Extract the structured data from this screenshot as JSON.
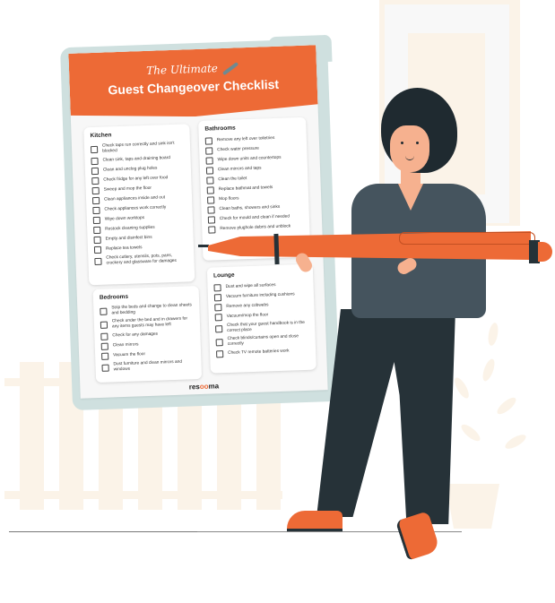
{
  "header": {
    "title_small": "The Ultimate",
    "title_big": "Guest Changeover Checklist"
  },
  "sections": {
    "kitchen": {
      "heading": "Kitchen",
      "items": [
        "Check taps run correctly and sink isn't blocked",
        "Clean sink, taps and draining board",
        "Clean and unclog plug holes",
        "Check fridge for any left over food",
        "Sweep and mop the floor",
        "Clean appliances inside and out",
        "Check appliances work correctly",
        "Wipe down worktops",
        "Restock cleaning supplies",
        "Empty and disinfect bins",
        "Replace tea towels",
        "Check cutlery, utensils, pots, pans, crockery and glassware for damages"
      ]
    },
    "bathrooms": {
      "heading": "Bathrooms",
      "items": [
        "Remove any left over toiletries",
        "Check water pressure",
        "Wipe down units and countertops",
        "Clean mirrors and taps",
        "Clean the toilet",
        "Replace bathmat and towels",
        "Mop floors",
        "Clean baths, showers and sinks",
        "Check for mould and clean if needed",
        "Remove plughole debris and unblock"
      ]
    },
    "bedrooms": {
      "heading": "Bedrooms",
      "items": [
        "Strip the beds and change to clean sheets and bedding",
        "Check under the bed and in drawers for any items guests may have left",
        "Check for any damages",
        "Clean mirrors",
        "Vacuum the floor",
        "Dust furniture and clean mirrors and windows"
      ]
    },
    "lounge": {
      "heading": "Lounge",
      "items": [
        "Dust and wipe all surfaces",
        "Vacuum furniture including cushions",
        "Remove any cobwebs",
        "Vacuum/mop the floor",
        "Check that your guest handbook is in the correct place",
        "Check blinds/curtains open and close correctly",
        "Check TV remote batteries work"
      ]
    }
  },
  "brand": {
    "prefix": "res",
    "accent": "oo",
    "suffix": "ma"
  },
  "colors": {
    "accent": "#ed6a36",
    "board": "#cfe0df",
    "dark": "#263238",
    "shirt": "#45545e",
    "cream": "#fbf3e8"
  }
}
